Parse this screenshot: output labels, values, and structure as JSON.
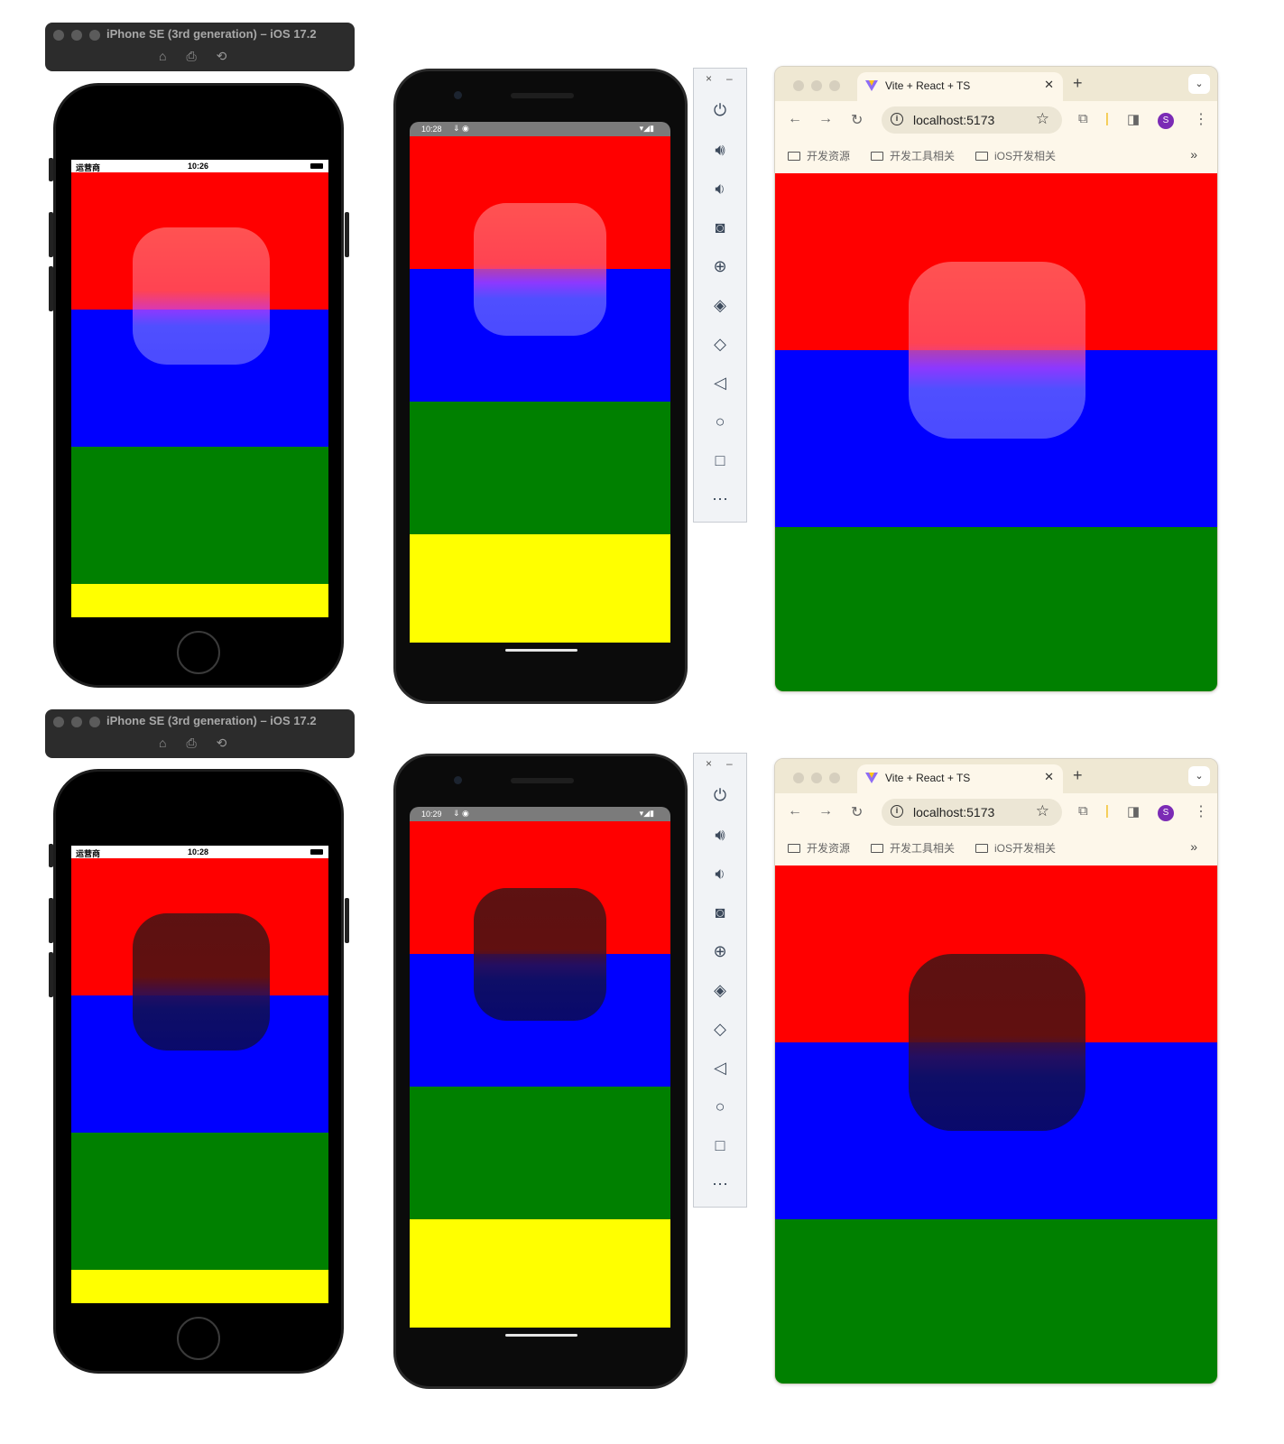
{
  "ios_window": {
    "title": "iPhone SE (3rd generation) – iOS 17.2",
    "home_icon": "home-icon",
    "screenshot_icon": "camera-icon",
    "rotate_icon": "rotate-icon"
  },
  "top": {
    "ios_status": {
      "carrier": "运营商",
      "time": "10:26"
    },
    "android_status": {
      "time": "10:28"
    }
  },
  "bottom": {
    "ios_status": {
      "carrier": "运营商",
      "time": "10:28"
    },
    "android_status": {
      "time": "10:29"
    }
  },
  "android_status_icons": "⇓ ◉",
  "android_status_right": "▾◢▮",
  "emulator_toolbar": {
    "close": "×",
    "minimize": "–",
    "buttons": [
      "power-icon",
      "volume-up-icon",
      "volume-down-icon",
      "camera-icon",
      "zoom-icon",
      "rotate-left-icon",
      "rotate-right-icon",
      "back-icon",
      "home-icon",
      "overview-icon",
      "more-icon"
    ]
  },
  "chrome": {
    "tab_title": "Vite + React + TS",
    "url": "localhost:5173",
    "avatar_letter": "S",
    "bookmarks": [
      "开发资源",
      "开发工具相关",
      "iOS开发相关"
    ],
    "more_bookmarks": "»"
  },
  "colors": {
    "band_red": "#ff0000",
    "band_blue": "#0000ff",
    "band_green": "#008000",
    "band_yellow": "#ffff00",
    "avatar": "#7b2bb5"
  }
}
